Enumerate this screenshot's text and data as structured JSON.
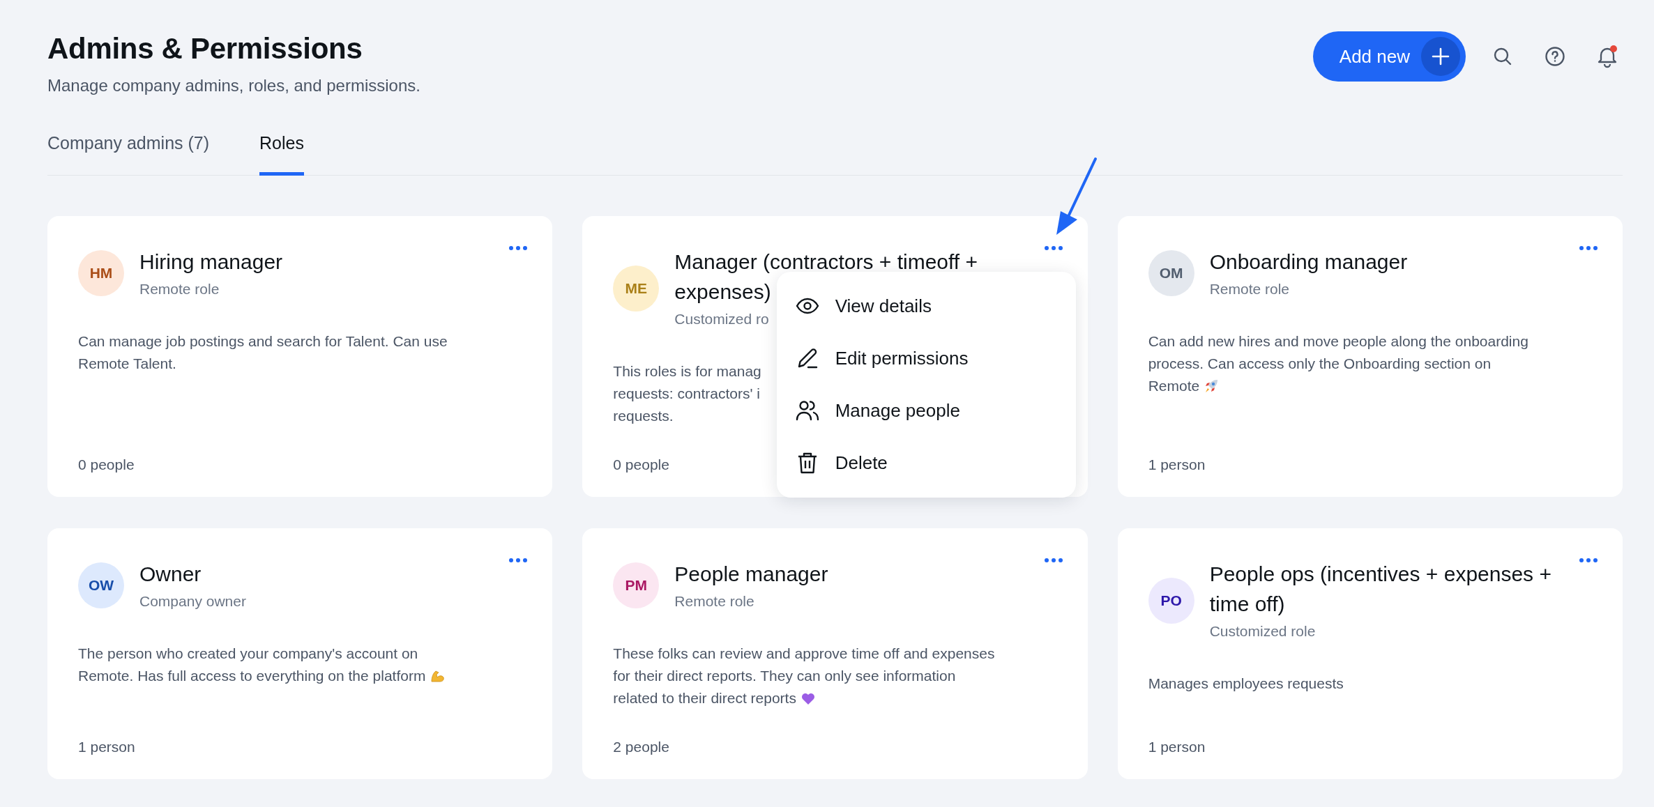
{
  "header": {
    "title": "Admins & Permissions",
    "subtitle": "Manage company admins, roles, and permissions.",
    "add_button": "Add new",
    "has_notification": true
  },
  "tabs": [
    {
      "label": "Company admins (7)",
      "selected": false
    },
    {
      "label": "Roles",
      "selected": true
    }
  ],
  "roles": [
    {
      "initials": "HM",
      "color": "#fde7da",
      "title_lines": [
        "Hiring manager"
      ],
      "subtitle": "Remote role",
      "description_lines": [
        {
          "kind": "text",
          "text": "Can manage job postings and search for Talent. Can use"
        },
        {
          "kind": "text",
          "text": "Remote Talent."
        }
      ],
      "people": "0 people"
    },
    {
      "initials": "ME",
      "color": "#fdefcb",
      "title_lines": [
        "Manager (contractors + timeoff +",
        "expenses)"
      ],
      "subtitle": "Customized ro",
      "description_lines": [
        {
          "kind": "text",
          "text": "This roles is for manag"
        },
        {
          "kind": "text",
          "text": "requests: contractors' i"
        },
        {
          "kind": "text",
          "text": "requests."
        }
      ],
      "people": "0 people",
      "menu_open": true
    },
    {
      "initials": "OM",
      "color": "#e4e8ee",
      "title_lines": [
        "Onboarding manager"
      ],
      "subtitle": "Remote role",
      "description_lines": [
        {
          "kind": "text",
          "text": "Can add new hires and move people along the onboarding"
        },
        {
          "kind": "text",
          "text": "process. Can access only the Onboarding section on"
        },
        {
          "kind": "rocket",
          "text": "Remote"
        }
      ],
      "people": "1 person"
    },
    {
      "initials": "OW",
      "color": "#dde9fd",
      "title_lines": [
        "Owner"
      ],
      "subtitle": "Company owner",
      "description_lines": [
        {
          "kind": "text",
          "text": "The person who created your company's account on"
        },
        {
          "kind": "arm",
          "text": "Remote. Has full access to everything on the platform"
        }
      ],
      "people": "1 person"
    },
    {
      "initials": "PM",
      "color": "#fbe6f1",
      "title_lines": [
        "People manager"
      ],
      "subtitle": "Remote role",
      "description_lines": [
        {
          "kind": "text",
          "text": "These folks can review and approve time off and expenses"
        },
        {
          "kind": "text",
          "text": "for their direct reports. They can only see information"
        },
        {
          "kind": "heart",
          "text": "related to their direct reports"
        }
      ],
      "people": "2 people"
    },
    {
      "initials": "PO",
      "color": "#ece9fd",
      "title_lines": [
        "People ops (incentives + expenses +",
        "time off)"
      ],
      "subtitle": "Customized role",
      "description_lines": [
        {
          "kind": "text",
          "text": "Manages employees requests"
        }
      ],
      "people": "1 person"
    }
  ],
  "menu": [
    {
      "kind": "view",
      "label": "View details"
    },
    {
      "kind": "edit",
      "label": "Edit permissions"
    },
    {
      "kind": "people",
      "label": "Manage people"
    },
    {
      "kind": "delete",
      "label": "Delete"
    }
  ]
}
